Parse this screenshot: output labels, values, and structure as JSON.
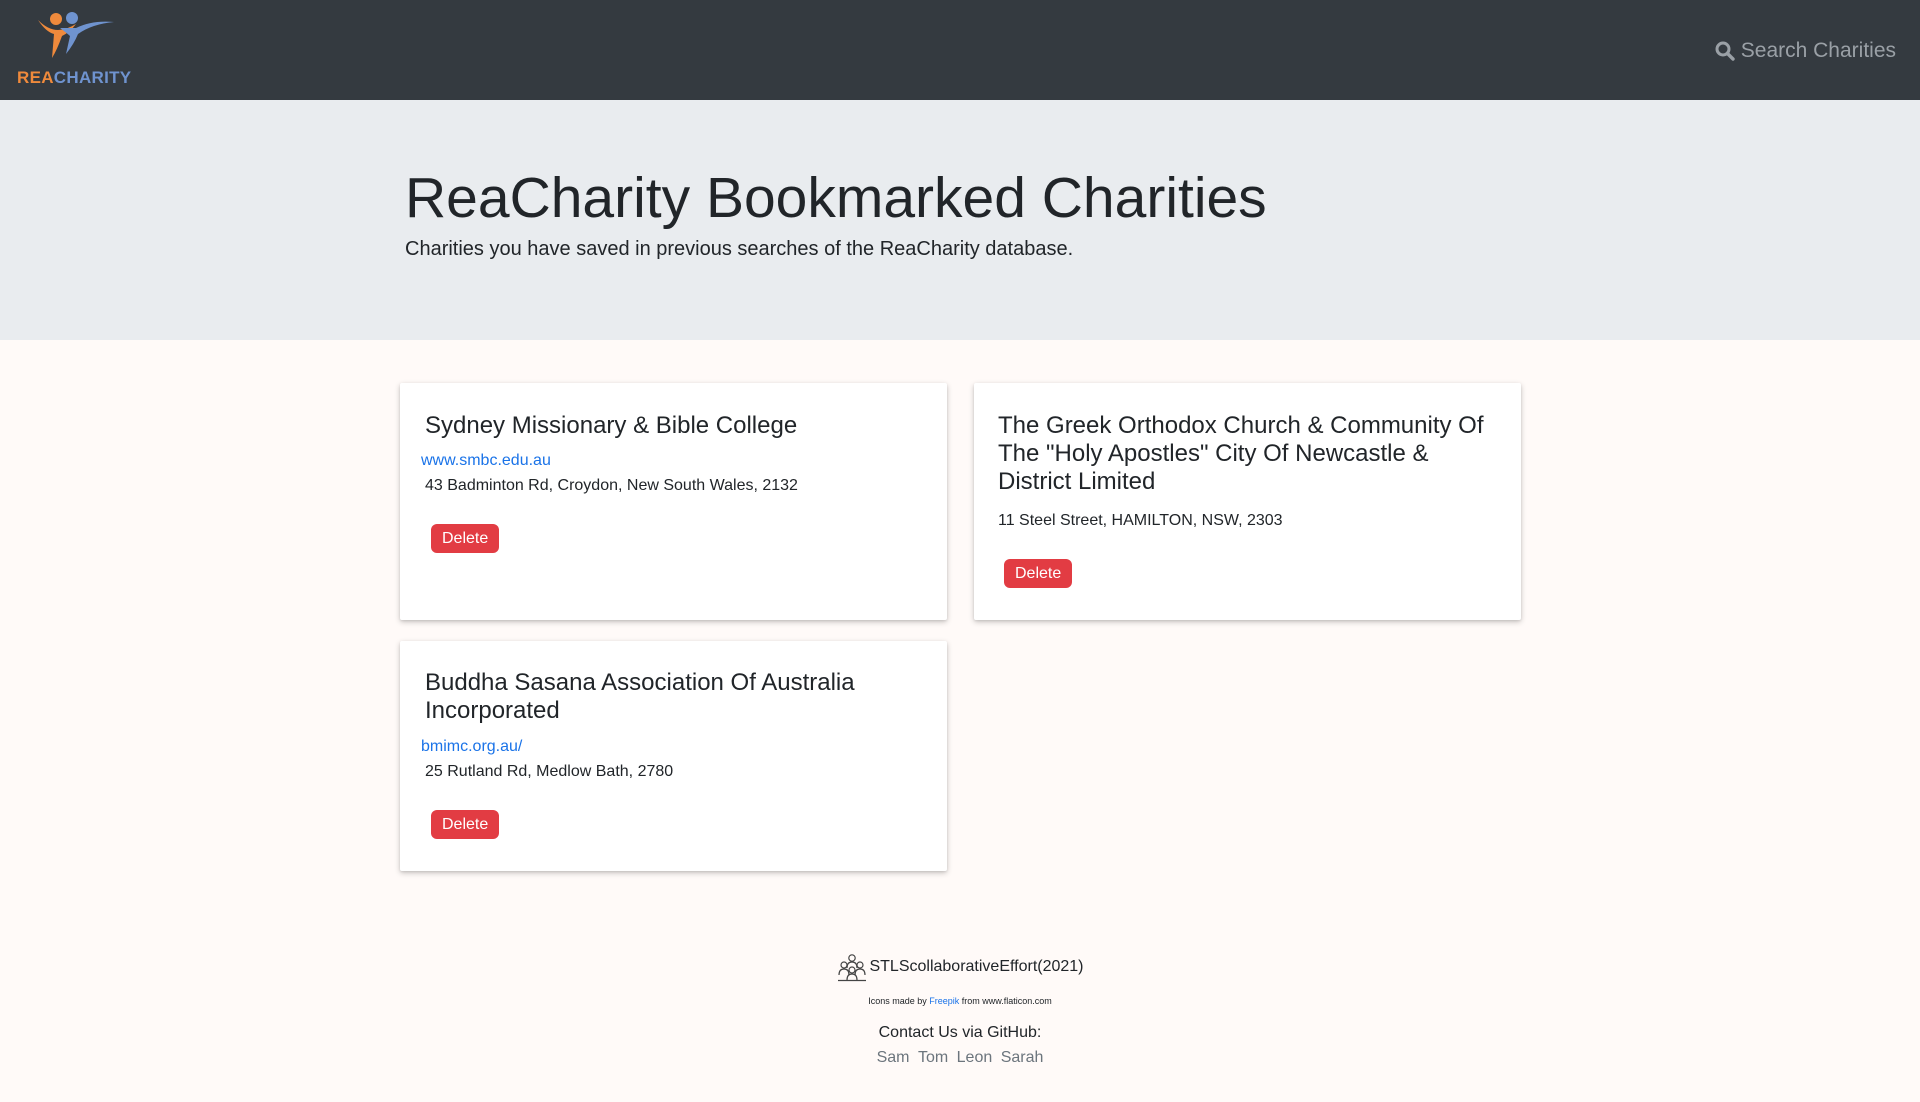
{
  "navbar": {
    "brand_rea": "REA",
    "brand_charity": "CHARITY",
    "search_label": "Search Charities"
  },
  "jumbotron": {
    "title": "ReaCharity Bookmarked Charities",
    "subtitle": "Charities you have saved in previous searches of the ReaCharity database."
  },
  "charities": [
    {
      "name": "Sydney Missionary & Bible College",
      "website": "www.smbc.edu.au",
      "address": "43 Badminton Rd, Croydon, New South Wales, 2132",
      "delete_label": "Delete"
    },
    {
      "name": "The Greek Orthodox Church & Community Of The \"Holy Apostles\" City Of Newcastle & District Limited",
      "website": "",
      "address": "11 Steel Street, HAMILTON, NSW, 2303",
      "delete_label": "Delete"
    },
    {
      "name": "Buddha Sasana Association Of Australia Incorporated",
      "website": "bmimc.org.au/",
      "address": "25 Rutland Rd, Medlow Bath, 2780",
      "delete_label": "Delete"
    }
  ],
  "footer": {
    "team": "STLScollaborativeEffort(2021)",
    "credit_prefix": "Icons made by",
    "credit_author": "Freepik",
    "credit_from": "from",
    "credit_site": "www.flaticon.com",
    "contact": "Contact Us via GitHub:",
    "members": [
      "Sam",
      "Tom",
      "Leon",
      "Sarah"
    ]
  },
  "colors": {
    "navbar_bg": "#343a40",
    "jumbotron_bg": "#e9ecef",
    "page_bg": "#fffaf8",
    "delete_button": "#e23c43",
    "link": "#1a73e8",
    "brand_orange": "#ef8a3c",
    "brand_blue": "#6f93cf"
  },
  "icons": {
    "brand_logo": "people-cheering-logo",
    "search": "search-icon",
    "team": "people-group-icon"
  }
}
